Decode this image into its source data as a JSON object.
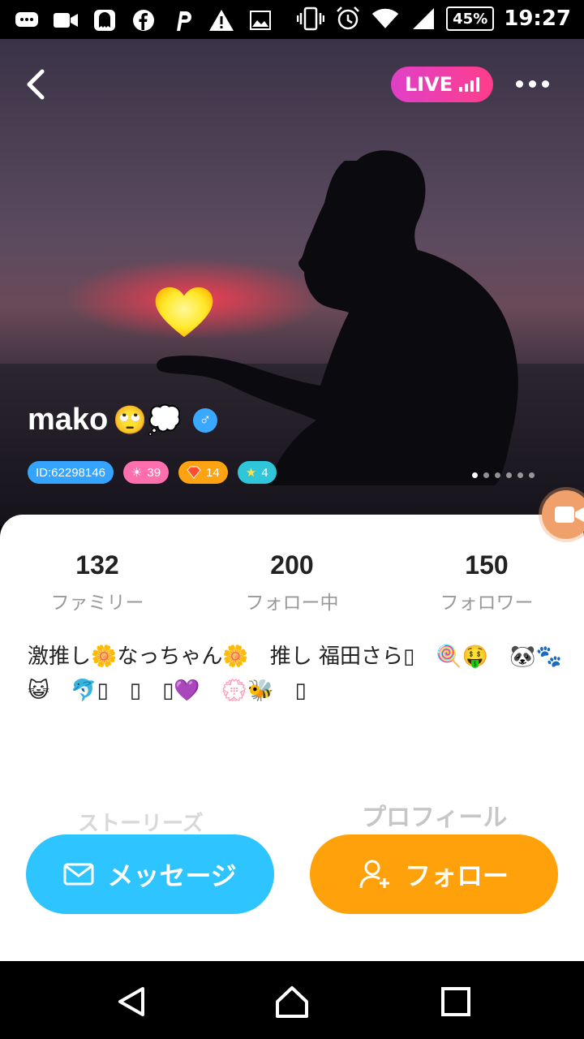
{
  "status_bar": {
    "battery": "45%",
    "time": "19:27",
    "icons": [
      "message-icon",
      "video-icon",
      "ghost-icon",
      "facebook-icon",
      "p-icon",
      "warning-icon",
      "image-icon",
      "vibrate-icon",
      "alarm-icon",
      "wifi-icon",
      "signal-icon"
    ]
  },
  "header": {
    "live_label": "LIVE"
  },
  "profile": {
    "name": "mako",
    "emoji": "🙄💭",
    "gender_symbol": "♂",
    "id_badge": "ID:62298146",
    "sun_level": "39",
    "gem_level": "14",
    "star_level": "4",
    "photo_count": 6,
    "current_photo": 1
  },
  "stats": [
    {
      "value": "132",
      "label": "ファミリー"
    },
    {
      "value": "200",
      "label": "フォロー中"
    },
    {
      "value": "150",
      "label": "フォロワー"
    }
  ],
  "bio": {
    "line1": "激推し🌼なっちゃん🌼　推し 福田さら▯　🍭🤑　🐼🐾",
    "line2": "😺　🐬▯　▯　▯💜　💮🐝　▯"
  },
  "tabs": {
    "stories": "ストーリーズ",
    "profile": "プロフィール"
  },
  "actions": {
    "message": "メッセージ",
    "follow": "フォロー"
  },
  "colors": {
    "message_btn": "#2ec4ff",
    "follow_btn": "#ffa10a",
    "live_gradient_start": "#e040c8",
    "live_gradient_end": "#ff3d8a"
  }
}
